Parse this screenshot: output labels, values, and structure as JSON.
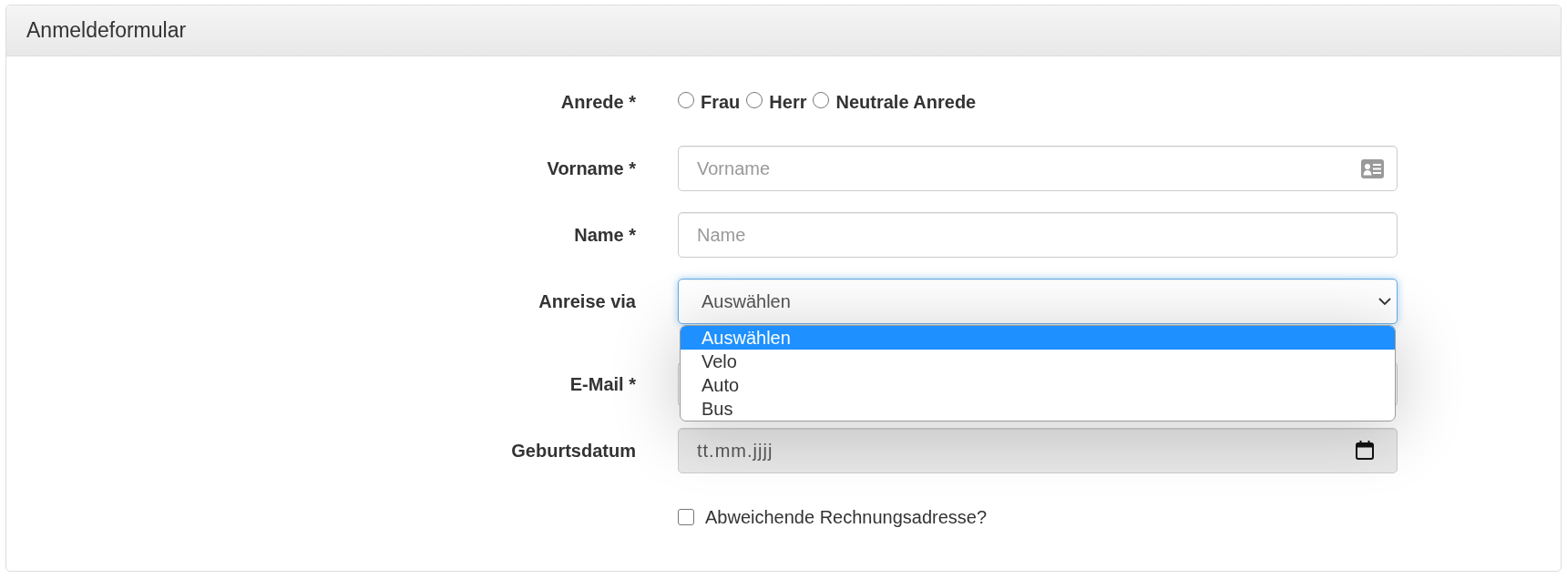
{
  "panel": {
    "title": "Anmeldeformular"
  },
  "salutation": {
    "label": "Anrede *",
    "options": [
      {
        "label": "Frau",
        "selected": false
      },
      {
        "label": "Herr",
        "selected": false
      },
      {
        "label": "Neutrale Anrede",
        "selected": false
      }
    ]
  },
  "fields": [
    {
      "kind": "text",
      "label": "Vorname *",
      "placeholder": "Vorname",
      "has_icon": true,
      "focused": false,
      "readonly": false
    },
    {
      "kind": "text",
      "label": "Name *",
      "placeholder": "Name",
      "has_icon": false,
      "focused": false,
      "readonly": false
    },
    {
      "kind": "select",
      "label": "Anreise via",
      "value": "Auswählen",
      "focused": true,
      "readonly": false,
      "expanded": true,
      "options": [
        {
          "label": "Auswählen",
          "selected": true
        },
        {
          "label": "Velo",
          "selected": false
        },
        {
          "label": "Auto",
          "selected": false
        },
        {
          "label": "Bus",
          "selected": false
        }
      ]
    },
    {
      "kind": "text",
      "label": "E-Mail *"
    },
    {
      "kind": "date",
      "label": "Geburtsdatum",
      "placeholder": "tt.mm.jjjj",
      "focused": false,
      "readonly": true
    }
  ],
  "billing_checkbox": {
    "label": "Abweichende Rechnungsadresse?",
    "checked": false
  }
}
